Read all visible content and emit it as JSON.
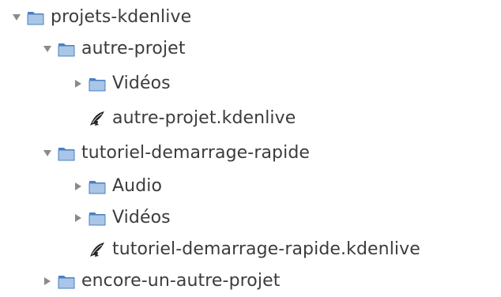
{
  "tree": {
    "nodes": [
      {
        "label": "projets-kdenlive",
        "type": "folder",
        "state": "expanded",
        "depth": 0
      },
      {
        "label": "autre-projet",
        "type": "folder",
        "state": "expanded",
        "depth": 1
      },
      {
        "label": "Vidéos",
        "type": "folder",
        "state": "collapsed",
        "depth": 2
      },
      {
        "label": "autre-projet.kdenlive",
        "type": "kdenlive-file",
        "state": "leaf",
        "depth": 2
      },
      {
        "label": "tutoriel-demarrage-rapide",
        "type": "folder",
        "state": "expanded",
        "depth": 1
      },
      {
        "label": "Audio",
        "type": "folder",
        "state": "collapsed",
        "depth": 2
      },
      {
        "label": "Vidéos",
        "type": "folder",
        "state": "collapsed",
        "depth": 2
      },
      {
        "label": "tutoriel-demarrage-rapide.kdenlive",
        "type": "kdenlive-file",
        "state": "leaf",
        "depth": 2
      },
      {
        "label": "encore-un-autre-projet",
        "type": "folder",
        "state": "collapsed",
        "depth": 1
      }
    ]
  },
  "colors": {
    "folder_light": "#a9c6e8",
    "folder_dark": "#4a7fc1",
    "expander": "#8a8a8a",
    "text": "#3c3c3c"
  },
  "icons": {
    "folder": "folder-icon",
    "file": "kdenlive-file-icon",
    "expanded": "triangle-down-icon",
    "collapsed": "triangle-right-icon"
  }
}
